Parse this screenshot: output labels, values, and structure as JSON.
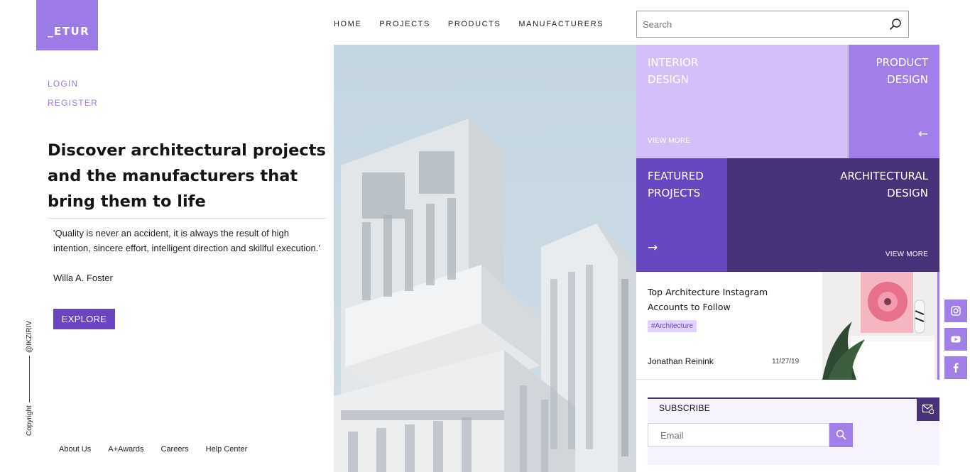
{
  "brand": {
    "logo": "_ETUR",
    "color": "#9c7be6"
  },
  "auth": {
    "login": "LOGIN",
    "register": "REGISTER"
  },
  "nav": {
    "items": [
      "HOME",
      "PROJECTS",
      "PRODUCTS",
      "MANUFACTURERS"
    ]
  },
  "search": {
    "placeholder": "Search",
    "icon": "search-icon"
  },
  "hero": {
    "headline": "Discover architectural projects and the manufacturers that bring them to life",
    "quote": "'Quality is never an accident, it is always the result of high intention, sincere effort, intelligent direction and skillful execution.'",
    "quote_author": "Willa A. Foster",
    "explore_label": "EXPLORE"
  },
  "side": {
    "copyright": "Copyright",
    "handle": "@IKZIRIV"
  },
  "footer": {
    "links": [
      "About Us",
      "A+Awards",
      "Careers",
      "Help Center"
    ]
  },
  "tiles": {
    "interior": {
      "line1": "INTERIOR",
      "line2": "DESIGN",
      "more": "VIEW MORE",
      "color": "#d5bff8"
    },
    "product": {
      "line1": "PRODUCT",
      "line2": "DESIGN",
      "arrow": "←",
      "color": "#a27ee9"
    },
    "featured": {
      "line1": "FEATURED",
      "line2": "PROJECTS",
      "arrow": "→",
      "color": "#6a47c2"
    },
    "architectural": {
      "line1": "ARCHITECTURAL",
      "line2": "DESIGN",
      "more": "VIEW MORE",
      "color": "#47327a"
    }
  },
  "article": {
    "title": "Top Architecture Instagram Accounts to Follow",
    "tag": "#Architecture",
    "author": "Jonathan Reinink",
    "date": "11/27/19"
  },
  "subscribe": {
    "label": "SUBSCRIBE",
    "placeholder": "Email",
    "icon": "mail-icon",
    "button_icon": "search-icon"
  },
  "social": [
    "instagram-icon",
    "youtube-icon",
    "facebook-icon"
  ]
}
